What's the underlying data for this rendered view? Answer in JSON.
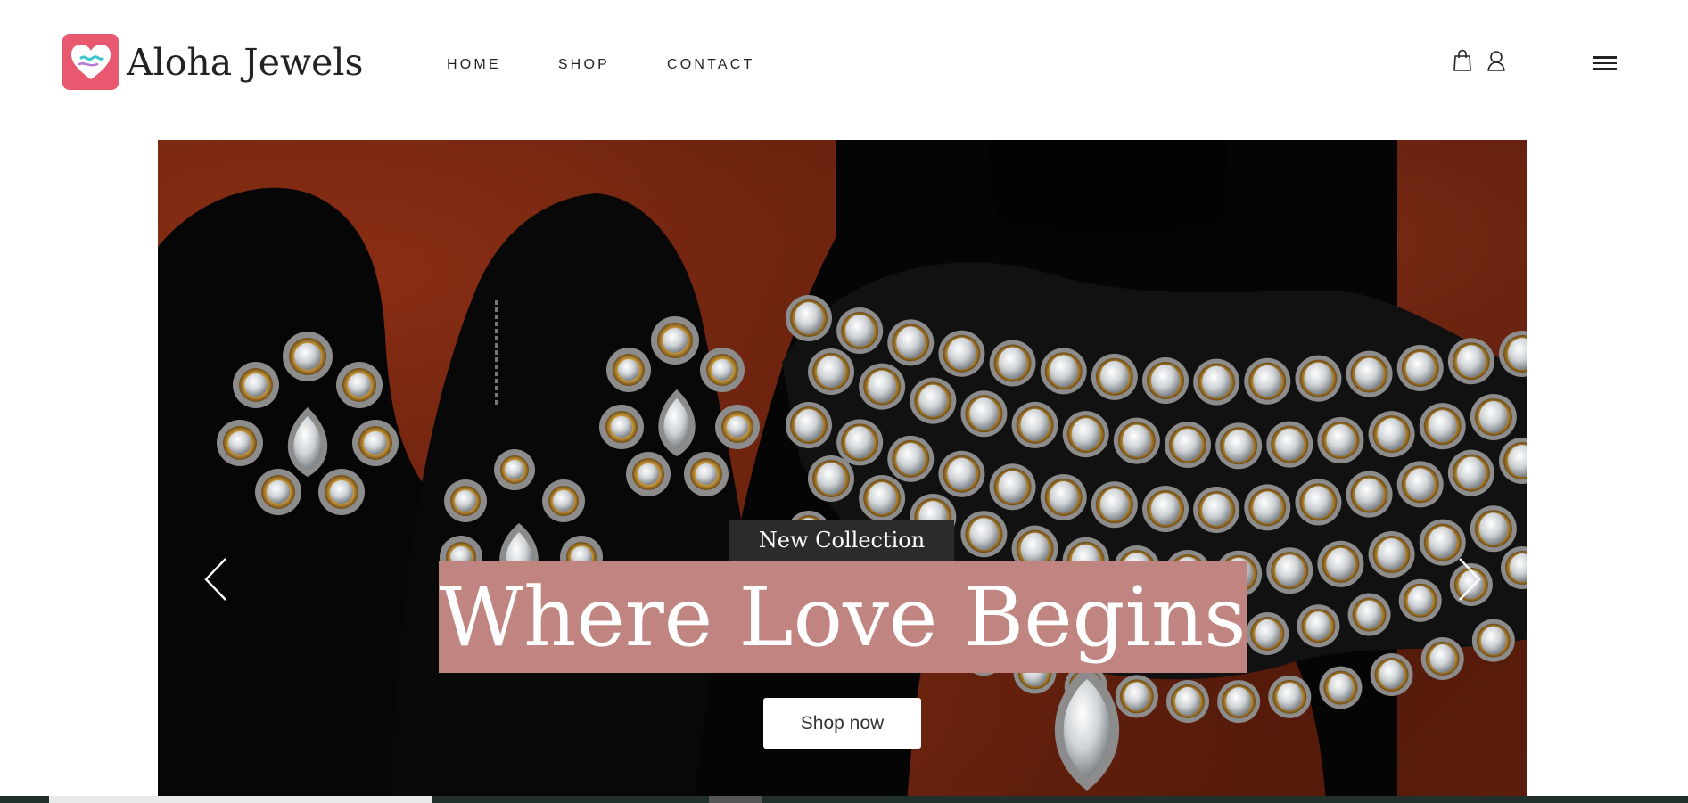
{
  "brand": {
    "name": "Aloha Jewels",
    "logo_icon": "heart-logo-icon",
    "logo_color": "#e8586f"
  },
  "nav": {
    "items": [
      {
        "label": "HOME"
      },
      {
        "label": "SHOP"
      },
      {
        "label": "CONTACT"
      }
    ]
  },
  "header_icons": {
    "cart": "shopping-bag-icon",
    "account": "user-icon",
    "menu": "hamburger-menu-icon"
  },
  "hero": {
    "tag": "New Collection",
    "title": "Where Love Begins",
    "cta_label": "Shop now",
    "prev_icon": "chevron-left-icon",
    "next_icon": "chevron-right-icon",
    "tag_color": "#2b2b2b",
    "title_bg_color": "#c08581",
    "background_color": "#6e2410"
  }
}
